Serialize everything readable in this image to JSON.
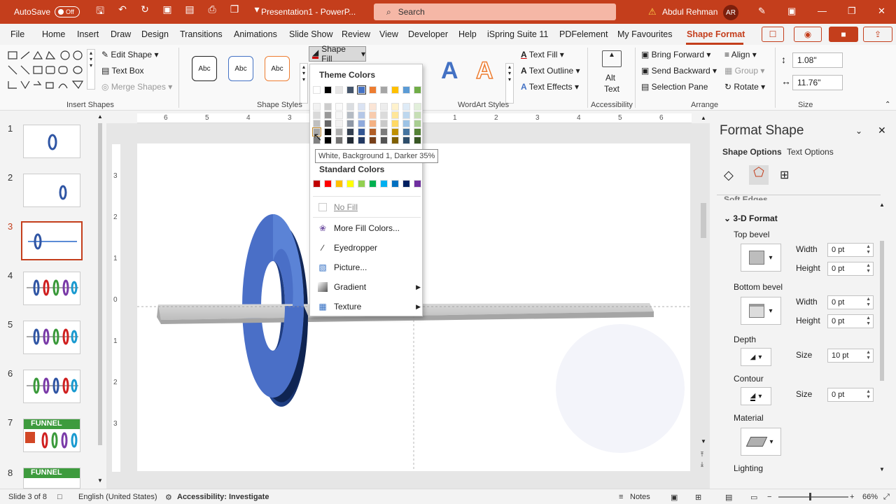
{
  "titlebar": {
    "autosave_label": "AutoSave",
    "autosave_state": "Off",
    "document_title": "Presentation1 - PowerP...",
    "search_placeholder": "Search",
    "user_name": "Abdul Rehman",
    "user_initials": "AR",
    "accent_color": "#c43e1c"
  },
  "menu": {
    "tabs": [
      "File",
      "Home",
      "Insert",
      "Draw",
      "Design",
      "Transitions",
      "Animations",
      "Slide Show",
      "Review",
      "View",
      "Developer",
      "Help",
      "iSpring Suite 11",
      "PDFelement",
      "My Favourites",
      "Shape Format"
    ],
    "active_tab": "Shape Format"
  },
  "ribbon": {
    "insert_shapes": {
      "edit_shape": "Edit Shape",
      "text_box": "Text Box",
      "merge_shapes": "Merge Shapes",
      "group_label": "Insert Shapes"
    },
    "shape_styles": {
      "samples": [
        "Abc",
        "Abc",
        "Abc"
      ],
      "shape_fill": "Shape Fill",
      "group_label": "Shape Styles"
    },
    "wordart": {
      "text_fill": "Text Fill",
      "text_outline": "Text Outline",
      "text_effects": "Text Effects",
      "group_label": "WordArt Styles"
    },
    "accessibility": {
      "alt_text_line1": "Alt",
      "alt_text_line2": "Text",
      "group_label": "Accessibility"
    },
    "arrange": {
      "bring_forward": "Bring Forward",
      "send_backward": "Send Backward",
      "selection_pane": "Selection Pane",
      "align": "Align",
      "group": "Group",
      "rotate": "Rotate",
      "group_label": "Arrange"
    },
    "size": {
      "height": "1.08\"",
      "width": "11.76\"",
      "group_label": "Size"
    }
  },
  "ruler": {
    "top_ticks": [
      "6",
      "5",
      "4",
      "3",
      "2",
      "1",
      "0",
      "1",
      "2",
      "3",
      "4",
      "5",
      "6"
    ],
    "left_ticks": [
      "3",
      "2",
      "1",
      "0",
      "1",
      "2",
      "3"
    ]
  },
  "slides": {
    "numbers": [
      "1",
      "2",
      "3",
      "4",
      "5",
      "6",
      "7",
      "8"
    ],
    "active": "3",
    "funnel_label": "FUNNEL"
  },
  "shape_fill_menu": {
    "theme_colors_heading": "Theme Colors",
    "theme_top_row": [
      "#ffffff",
      "#000000",
      "#e7e6e6",
      "#44546a",
      "#4472c4",
      "#ed7d31",
      "#a5a5a5",
      "#ffc000",
      "#5b9bd5",
      "#70ad47"
    ],
    "standard_colors_heading": "Standard Colors",
    "standard_colors": [
      "#c00000",
      "#ff0000",
      "#ffc000",
      "#ffff00",
      "#92d050",
      "#00b050",
      "#00b0f0",
      "#0070c0",
      "#002060",
      "#7030a0"
    ],
    "no_fill": "No Fill",
    "more_fill_colors": "More Fill Colors...",
    "eyedropper": "Eyedropper",
    "picture": "Picture...",
    "gradient": "Gradient",
    "texture": "Texture",
    "tooltip": "White, Background 1, Darker 35%"
  },
  "format_pane": {
    "title": "Format Shape",
    "tab_shape_options": "Shape Options",
    "tab_text_options": "Text Options",
    "section_prev": "Soft Edges",
    "section": "3-D Format",
    "top_bevel": "Top bevel",
    "bottom_bevel": "Bottom bevel",
    "width_label": "Width",
    "height_label": "Height",
    "top_width": "0 pt",
    "top_height": "0 pt",
    "bottom_width": "0 pt",
    "bottom_height": "0 pt",
    "depth": "Depth",
    "depth_size_label": "Size",
    "depth_size": "10 pt",
    "contour": "Contour",
    "contour_size_label": "Size",
    "contour_size": "0 pt",
    "material": "Material",
    "lighting": "Lighting"
  },
  "statusbar": {
    "slide_info": "Slide 3 of 8",
    "language": "English (United States)",
    "accessibility": "Accessibility: Investigate",
    "notes": "Notes",
    "zoom": "66%"
  }
}
